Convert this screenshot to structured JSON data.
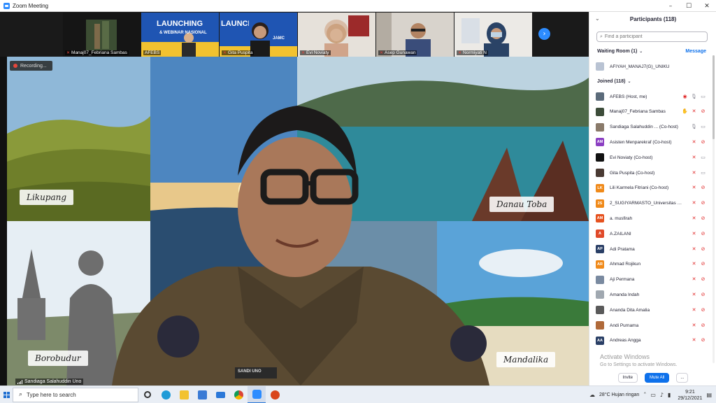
{
  "window": {
    "title": "Zoom Meeting",
    "controls": [
      "–",
      "☐",
      "✕"
    ]
  },
  "thumbnails": [
    {
      "name": "Manaj07_Febriana Sambas",
      "muted": true
    },
    {
      "name": "AFEBS",
      "muted": false,
      "screen_text": "LAUNCHING",
      "screen_text2": "& WEBINAR NASIONAL"
    },
    {
      "name": "Gita Puspita",
      "muted": true,
      "screen_text": "LAUNCHING",
      "screen_text2": "JAMC"
    },
    {
      "name": "Evi Noviaty",
      "muted": true
    },
    {
      "name": "Asep Gunawan",
      "muted": true
    },
    {
      "name": "Normiyati N",
      "muted": true
    }
  ],
  "recording": {
    "label": "Recording..."
  },
  "speaker": {
    "name": "Sandiaga Salahuddin Uno",
    "badge": "SANDI UNO"
  },
  "places": [
    "Likupang",
    "Danau Toba",
    "Borobudur",
    "Mandalika"
  ],
  "participants_panel": {
    "title": "Participants (118)",
    "search_placeholder": "Find a participant",
    "waiting_room_label": "Waiting Room (1)",
    "message_label": "Message",
    "joined_label": "Joined (118)",
    "waiting": [
      {
        "name": "AFIYAH_MANAJ7(G)_UNIKU",
        "initials": "",
        "color": "#b9c3d3"
      }
    ],
    "joined": [
      {
        "name": "AFEBS (Host, me)",
        "initials": "",
        "color": "#5b6b7a",
        "icons": [
          "rec",
          "mic",
          "cam"
        ]
      },
      {
        "name": "Manaj07_Febriana Sambas",
        "initials": "",
        "color": "#3d4d3a",
        "icons": [
          "hand",
          "micoff",
          "camoff"
        ]
      },
      {
        "name": "Sandiaga Salahuddin ...  (Co-host)",
        "initials": "",
        "color": "#8a7a6a",
        "icons": [
          "mic",
          "cam"
        ]
      },
      {
        "name": "Asisten Menparekraf (Co-host)",
        "initials": "AM",
        "color": "#8b3fc2",
        "icons": [
          "micoff",
          "camoff"
        ]
      },
      {
        "name": "Evi Noviaty (Co-host)",
        "initials": "",
        "color": "#111111",
        "icons": [
          "micoff",
          "cam"
        ]
      },
      {
        "name": "Gita Puspita (Co-host)",
        "initials": "",
        "color": "#4a3a33",
        "icons": [
          "micoff",
          "cam"
        ]
      },
      {
        "name": "Lili Karmela Fitriani (Co-host)",
        "initials": "LK",
        "color": "#f08a1a",
        "icons": [
          "micoff",
          "camoff"
        ]
      },
      {
        "name": "2_SUGIYARMASTO_Universitas S...",
        "initials": "2S",
        "color": "#f08a1a",
        "icons": [
          "micoff",
          "camoff"
        ]
      },
      {
        "name": "a. musfirah",
        "initials": "AM",
        "color": "#e6521f",
        "icons": [
          "micoff",
          "camoff"
        ]
      },
      {
        "name": "A.ZAILANI",
        "initials": "A",
        "color": "#e04a2a",
        "icons": [
          "micoff",
          "camoff"
        ]
      },
      {
        "name": "Adi Pratama",
        "initials": "AP",
        "color": "#2a3f66",
        "icons": [
          "micoff",
          "camoff"
        ]
      },
      {
        "name": "Ahmad Rojikun",
        "initials": "AR",
        "color": "#f08a1a",
        "icons": [
          "micoff",
          "camoff"
        ]
      },
      {
        "name": "Aji Permana",
        "initials": "",
        "color": "#7a8aa0",
        "icons": [
          "micoff",
          "camoff"
        ]
      },
      {
        "name": "Amanda Indah",
        "initials": "",
        "color": "#a0a8b0",
        "icons": [
          "micoff",
          "camoff"
        ]
      },
      {
        "name": "Ananda Dita Amalia",
        "initials": "",
        "color": "#5a5a5a",
        "icons": [
          "micoff",
          "camoff"
        ]
      },
      {
        "name": "Andi Purnama",
        "initials": "",
        "color": "#b06a3a",
        "icons": [
          "micoff",
          "camoff"
        ]
      },
      {
        "name": "Andreas Angga",
        "initials": "AA",
        "color": "#2a3f66",
        "icons": [
          "micoff",
          "camoff"
        ]
      }
    ],
    "invite_label": "Invite",
    "mute_all_label": "Mute All",
    "more_label": "..."
  },
  "watermark": {
    "line1": "Activate Windows",
    "line2": "Go to Settings to activate Windows."
  },
  "taskbar": {
    "search_placeholder": "Type here to search",
    "apps": [
      "task-view",
      "edge",
      "file-explorer",
      "store",
      "mail",
      "chrome",
      "zoom",
      "app"
    ],
    "weather": "28°C  Hujan ringan",
    "time": "9:21",
    "date": "29/12/2021"
  },
  "colors": {
    "accent": "#0e71eb",
    "muted_red": "#e02828",
    "zoom_blue": "#2d8cff"
  }
}
